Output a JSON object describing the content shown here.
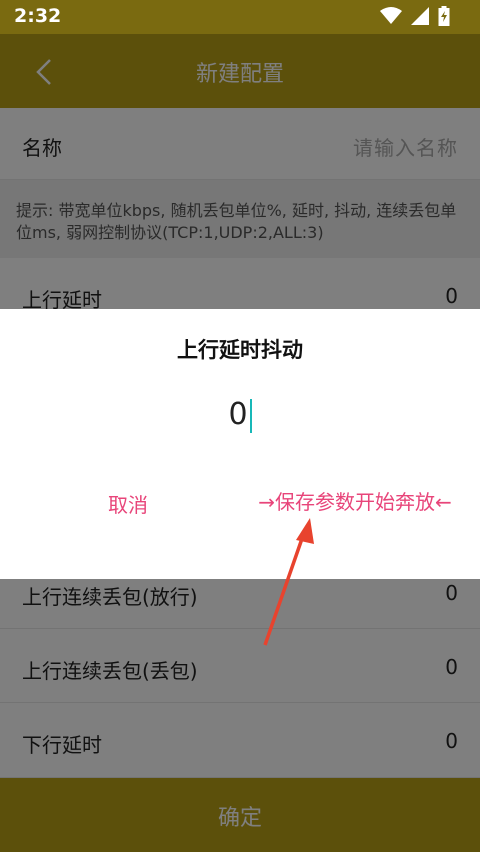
{
  "status": {
    "time": "2:32"
  },
  "header": {
    "title": "新建配置"
  },
  "form": {
    "name_label": "名称",
    "name_placeholder": "请输入名称",
    "hint": "提示: 带宽单位kbps, 随机丢包单位%, 延时, 抖动, 连续丢包单位ms, 弱网控制协议(TCP:1,UDP:2,ALL:3)",
    "rows": [
      {
        "label": "上行延时",
        "value": "0"
      },
      {
        "label": "上行连续丢包(放行)",
        "value": "0"
      },
      {
        "label": "上行连续丢包(丢包)",
        "value": "0"
      },
      {
        "label": "下行延时",
        "value": "0"
      }
    ]
  },
  "footer": {
    "confirm_label": "确定"
  },
  "dialog": {
    "title": "上行延时抖动",
    "input_value": "0",
    "cancel_label": "取消",
    "save_label": "→保存参数开始奔放←"
  },
  "colors": {
    "header_bg": "#b8a017",
    "accent_pink": "#e8457a",
    "arrow_red": "#e8432e",
    "caret_teal": "#18b8b8"
  }
}
